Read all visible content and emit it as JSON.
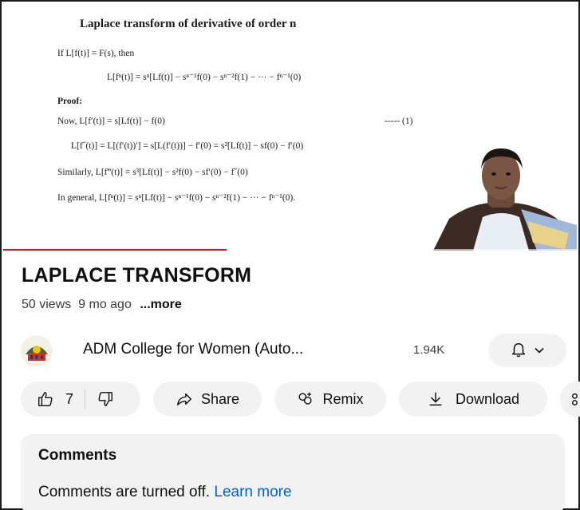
{
  "slide": {
    "title": "Laplace transform of derivative of order n",
    "lines": [
      "If  L[f(t)] = F(s),  then",
      "L[fⁿ(t)] = sⁿ[Lf(t)] − sⁿ⁻¹f(0) − sⁿ⁻²f(1) − ··· − fⁿ⁻¹(0)",
      "Proof:",
      "Now, L[f′(t)] = s[Lf(t)] − f(0)",
      "----- (1)",
      "L[f˝(t)]      = L[(f′(t))′] = s[L(f′(t))] − f′(0) = s²[Lf(t)] − sf(0) − f′(0)",
      "Similarly, L[f‴(t)] = s³[Lf(t)] − s²f(0) − sf′(0) − f˝(0)",
      "In general, L[fⁿ(t)] = sⁿ[Lf(t)] − sⁿ⁻¹f(0) − sⁿ⁻²f(1) − ··· − fⁿ⁻¹(0)."
    ]
  },
  "video": {
    "title": "LAPLACE TRANSFORM",
    "views": "50 views",
    "age": "9 mo ago",
    "more": "...more",
    "progress_fraction": 0.39
  },
  "channel": {
    "name": "ADM College for Women (Auto...",
    "subscribers": "1.94K"
  },
  "actions": {
    "like_count": "7",
    "share": "Share",
    "remix": "Remix",
    "download": "Download"
  },
  "comments": {
    "title": "Comments",
    "status": "Comments are turned off.",
    "link": "Learn more"
  },
  "colors": {
    "accent": "#ff0033",
    "link": "#065fd4",
    "pill": "#f2f2f2"
  },
  "icons": [
    "thumbs-up-icon",
    "thumbs-down-icon",
    "share-icon",
    "remix-icon",
    "download-icon",
    "bell-icon",
    "chevron-down-icon",
    "more-icon"
  ]
}
